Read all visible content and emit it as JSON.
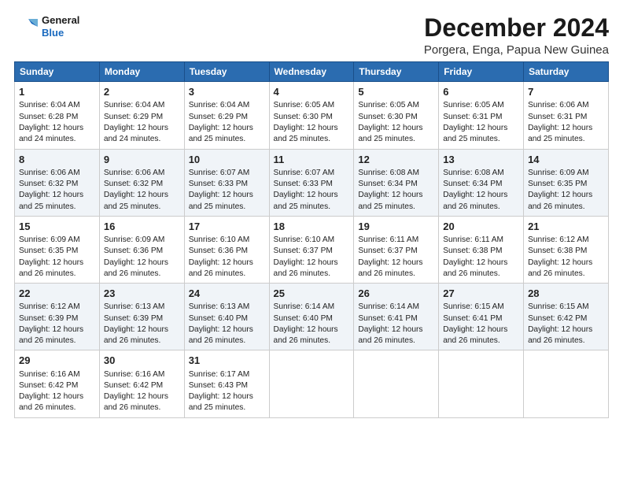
{
  "logo": {
    "line1": "General",
    "line2": "Blue"
  },
  "title": "December 2024",
  "subtitle": "Porgera, Enga, Papua New Guinea",
  "days_of_week": [
    "Sunday",
    "Monday",
    "Tuesday",
    "Wednesday",
    "Thursday",
    "Friday",
    "Saturday"
  ],
  "weeks": [
    [
      {
        "day": 1,
        "rise": "6:04 AM",
        "set": "6:28 PM",
        "daylight": "12 hours and 24 minutes."
      },
      {
        "day": 2,
        "rise": "6:04 AM",
        "set": "6:29 PM",
        "daylight": "12 hours and 24 minutes."
      },
      {
        "day": 3,
        "rise": "6:04 AM",
        "set": "6:29 PM",
        "daylight": "12 hours and 25 minutes."
      },
      {
        "day": 4,
        "rise": "6:05 AM",
        "set": "6:30 PM",
        "daylight": "12 hours and 25 minutes."
      },
      {
        "day": 5,
        "rise": "6:05 AM",
        "set": "6:30 PM",
        "daylight": "12 hours and 25 minutes."
      },
      {
        "day": 6,
        "rise": "6:05 AM",
        "set": "6:31 PM",
        "daylight": "12 hours and 25 minutes."
      },
      {
        "day": 7,
        "rise": "6:06 AM",
        "set": "6:31 PM",
        "daylight": "12 hours and 25 minutes."
      }
    ],
    [
      {
        "day": 8,
        "rise": "6:06 AM",
        "set": "6:32 PM",
        "daylight": "12 hours and 25 minutes."
      },
      {
        "day": 9,
        "rise": "6:06 AM",
        "set": "6:32 PM",
        "daylight": "12 hours and 25 minutes."
      },
      {
        "day": 10,
        "rise": "6:07 AM",
        "set": "6:33 PM",
        "daylight": "12 hours and 25 minutes."
      },
      {
        "day": 11,
        "rise": "6:07 AM",
        "set": "6:33 PM",
        "daylight": "12 hours and 25 minutes."
      },
      {
        "day": 12,
        "rise": "6:08 AM",
        "set": "6:34 PM",
        "daylight": "12 hours and 25 minutes."
      },
      {
        "day": 13,
        "rise": "6:08 AM",
        "set": "6:34 PM",
        "daylight": "12 hours and 26 minutes."
      },
      {
        "day": 14,
        "rise": "6:09 AM",
        "set": "6:35 PM",
        "daylight": "12 hours and 26 minutes."
      }
    ],
    [
      {
        "day": 15,
        "rise": "6:09 AM",
        "set": "6:35 PM",
        "daylight": "12 hours and 26 minutes."
      },
      {
        "day": 16,
        "rise": "6:09 AM",
        "set": "6:36 PM",
        "daylight": "12 hours and 26 minutes."
      },
      {
        "day": 17,
        "rise": "6:10 AM",
        "set": "6:36 PM",
        "daylight": "12 hours and 26 minutes."
      },
      {
        "day": 18,
        "rise": "6:10 AM",
        "set": "6:37 PM",
        "daylight": "12 hours and 26 minutes."
      },
      {
        "day": 19,
        "rise": "6:11 AM",
        "set": "6:37 PM",
        "daylight": "12 hours and 26 minutes."
      },
      {
        "day": 20,
        "rise": "6:11 AM",
        "set": "6:38 PM",
        "daylight": "12 hours and 26 minutes."
      },
      {
        "day": 21,
        "rise": "6:12 AM",
        "set": "6:38 PM",
        "daylight": "12 hours and 26 minutes."
      }
    ],
    [
      {
        "day": 22,
        "rise": "6:12 AM",
        "set": "6:39 PM",
        "daylight": "12 hours and 26 minutes."
      },
      {
        "day": 23,
        "rise": "6:13 AM",
        "set": "6:39 PM",
        "daylight": "12 hours and 26 minutes."
      },
      {
        "day": 24,
        "rise": "6:13 AM",
        "set": "6:40 PM",
        "daylight": "12 hours and 26 minutes."
      },
      {
        "day": 25,
        "rise": "6:14 AM",
        "set": "6:40 PM",
        "daylight": "12 hours and 26 minutes."
      },
      {
        "day": 26,
        "rise": "6:14 AM",
        "set": "6:41 PM",
        "daylight": "12 hours and 26 minutes."
      },
      {
        "day": 27,
        "rise": "6:15 AM",
        "set": "6:41 PM",
        "daylight": "12 hours and 26 minutes."
      },
      {
        "day": 28,
        "rise": "6:15 AM",
        "set": "6:42 PM",
        "daylight": "12 hours and 26 minutes."
      }
    ],
    [
      {
        "day": 29,
        "rise": "6:16 AM",
        "set": "6:42 PM",
        "daylight": "12 hours and 26 minutes."
      },
      {
        "day": 30,
        "rise": "6:16 AM",
        "set": "6:42 PM",
        "daylight": "12 hours and 26 minutes."
      },
      {
        "day": 31,
        "rise": "6:17 AM",
        "set": "6:43 PM",
        "daylight": "12 hours and 25 minutes."
      },
      null,
      null,
      null,
      null
    ]
  ]
}
